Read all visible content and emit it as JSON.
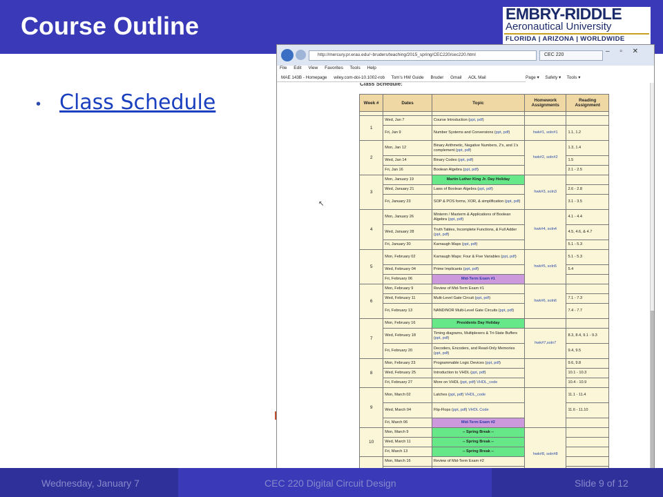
{
  "slide": {
    "title": "Course Outline",
    "bullet_link": "Class Schedule",
    "logo": {
      "line1": "EMBRY-RIDDLE",
      "line2": "Aeronautical University",
      "line3": "FLORIDA | ARIZONA | WORLDWIDE"
    },
    "footer": {
      "date": "Wednesday, January 7",
      "course": "CEC 220 Digital Circuit Design",
      "slide_number": "Slide 9 of 12"
    }
  },
  "browser": {
    "address": "http://mercury.pr.erau.edu/~bruders/teaching/2015_spring/CEC220/cec220.html",
    "tab_title": "CEC 220",
    "menu": [
      "File",
      "Edit",
      "View",
      "Favorites",
      "Tools",
      "Help"
    ],
    "favorites": [
      "MAE 143B - Homepage",
      "wiley.com-doi-10.1002-rob",
      "Tom's HW Guide",
      "Bruder",
      "Gmail",
      "AOL Mail"
    ],
    "commands": [
      "Page ▾",
      "Safety ▾",
      "Tools ▾"
    ],
    "heading": "Class Schedule:"
  },
  "schedule": {
    "headers": [
      "Week #",
      "Dates",
      "Topic",
      "Homework Assignments",
      "Reading Assignment"
    ]
  }
}
